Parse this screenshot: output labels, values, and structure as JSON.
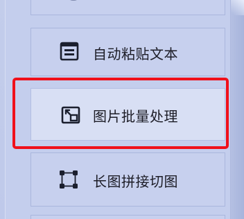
{
  "menu": {
    "items": [
      {
        "label": "自动粘贴文本",
        "icon": "text-window-icon"
      },
      {
        "label": "图片批量处理",
        "icon": "image-batch-icon"
      },
      {
        "label": "长图拼接切图",
        "icon": "crop-corners-icon"
      }
    ],
    "highlight_color": "#f0101a",
    "accent_icon_color": "#1b1f2e"
  }
}
